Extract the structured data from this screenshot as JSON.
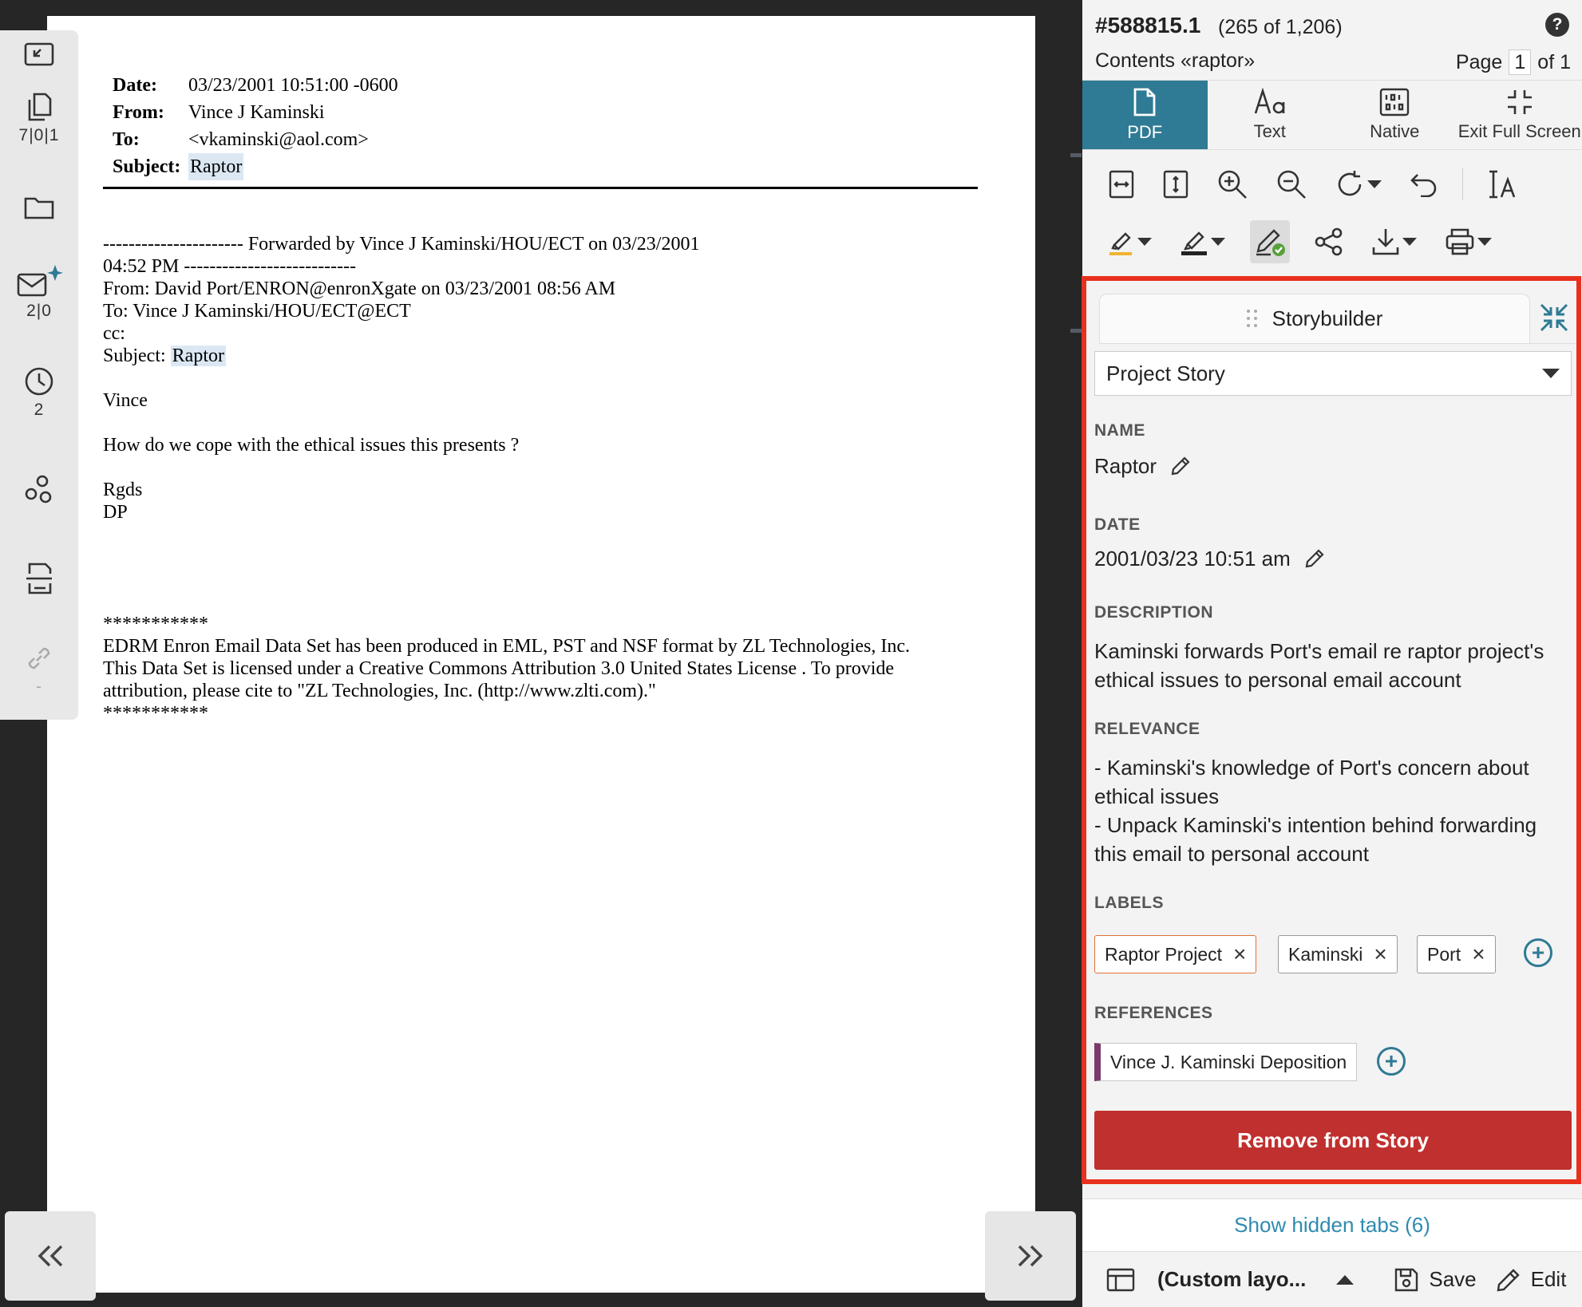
{
  "document": {
    "header": [
      {
        "key": "Date:",
        "value": "03/23/2001 10:51:00 -0600"
      },
      {
        "key": "From:",
        "value": "Vince J Kaminski"
      },
      {
        "key": "To:",
        "value": "<vkaminski@aol.com>"
      },
      {
        "key": "Subject:",
        "value": "Raptor"
      }
    ],
    "body_lines": [
      "---------------------- Forwarded by Vince J Kaminski/HOU/ECT on 03/23/2001",
      "04:52 PM ---------------------------",
      "From: David Port/ENRON@enronXgate on 03/23/2001 08:56 AM",
      "To: Vince J Kaminski/HOU/ECT@ECT",
      "cc:",
      "Subject: ",
      "",
      "Vince",
      "",
      "How do we cope with the ethical issues this presents ?",
      "",
      "Rgds",
      "DP",
      "",
      "",
      "",
      "",
      "***********",
      "EDRM Enron Email Data Set has been produced in EML, PST and NSF format by ZL Technologies, Inc.",
      "This Data Set is licensed under a Creative Commons Attribution 3.0 United States License . To provide",
      "attribution, please cite to \"ZL Technologies, Inc. (http://www.zlti.com).\"",
      "***********"
    ],
    "subject_highlight": "Raptor"
  },
  "sidebar": {
    "copies_count": "7|0|1",
    "email_count": "2|0",
    "history_count": "2",
    "links_count": "-"
  },
  "panel": {
    "doc_id": "#588815.1",
    "position": "(265 of 1,206)",
    "help": "?",
    "contents": "Contents «raptor»",
    "page_label": "Page",
    "page_current": "1",
    "page_total": "of 1",
    "tabs": [
      "PDF",
      "Text",
      "Native",
      "Exit Full Screen"
    ]
  },
  "storybuilder": {
    "tab_label": "Storybuilder",
    "story": "Project Story",
    "name_label": "NAME",
    "name": "Raptor",
    "date_label": "DATE",
    "date": "2001/03/23 10:51 am",
    "description_label": "DESCRIPTION",
    "description": "Kaminski forwards Port's email re raptor project's ethical issues to personal email account",
    "relevance_label": "RELEVANCE",
    "relevance_1": "- Kaminski's knowledge of Port's concern about ethical issues",
    "relevance_2": "- Unpack Kaminski's intention behind forwarding this email to personal account",
    "labels_label": "LABELS",
    "labels": [
      "Raptor Project",
      "Kaminski",
      "Port"
    ],
    "references_label": "REFERENCES",
    "reference": "Vince J. Kaminski Deposition",
    "remove_label": "Remove from Story"
  },
  "footer": {
    "hidden_tabs": "Show hidden tabs (6)",
    "layout": "(Custom layo...",
    "save": "Save",
    "edit": "Edit"
  },
  "colors": {
    "accent": "#2f7a94",
    "highlight_border": "#e8301e",
    "danger": "#c0302e",
    "reference_bar": "#7b3a6b"
  }
}
